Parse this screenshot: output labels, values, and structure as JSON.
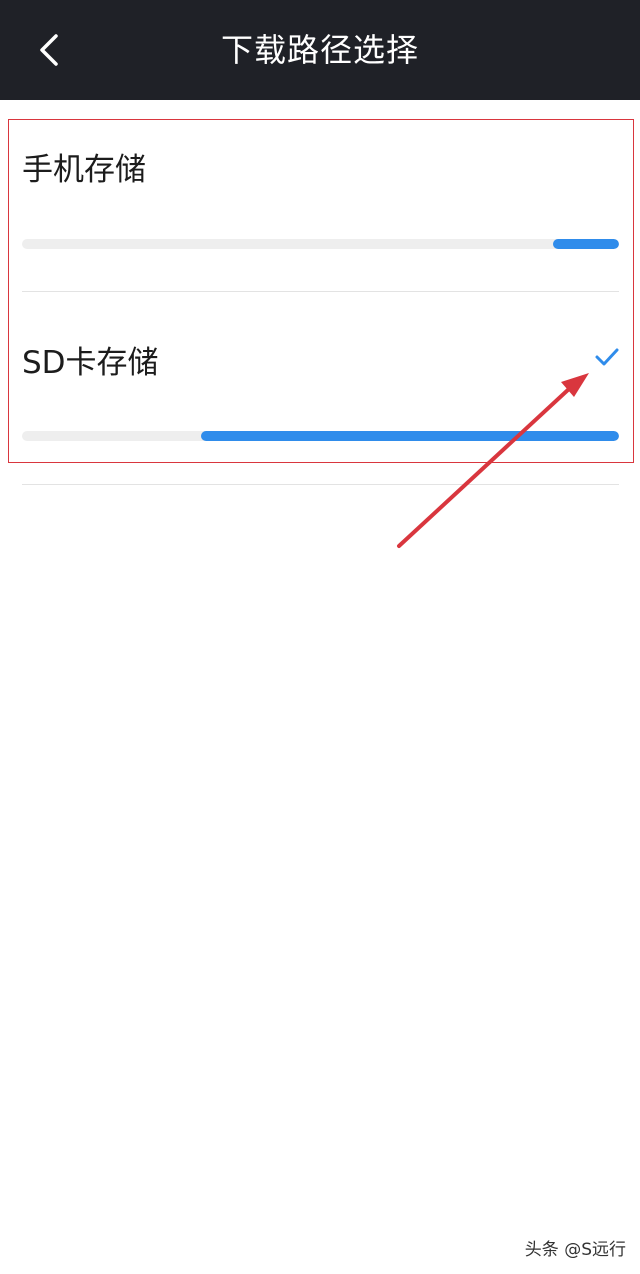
{
  "header": {
    "title": "下载路径选择",
    "back_icon": "chevron-left-icon",
    "background": "#1f2127"
  },
  "storage_options": [
    {
      "label": "手机存储",
      "used_fraction": 0.11,
      "selected": false
    },
    {
      "label": "SD卡存储",
      "used_fraction": 0.7,
      "selected": true,
      "selected_icon": "check-icon"
    }
  ],
  "colors": {
    "accent": "#2f8ceb",
    "track": "#eeeeee",
    "annotation": "#d9363e"
  },
  "annotation": {
    "type": "red-box-and-arrow",
    "target": "check-icon"
  },
  "watermark": {
    "text": "头条 @S远行"
  }
}
